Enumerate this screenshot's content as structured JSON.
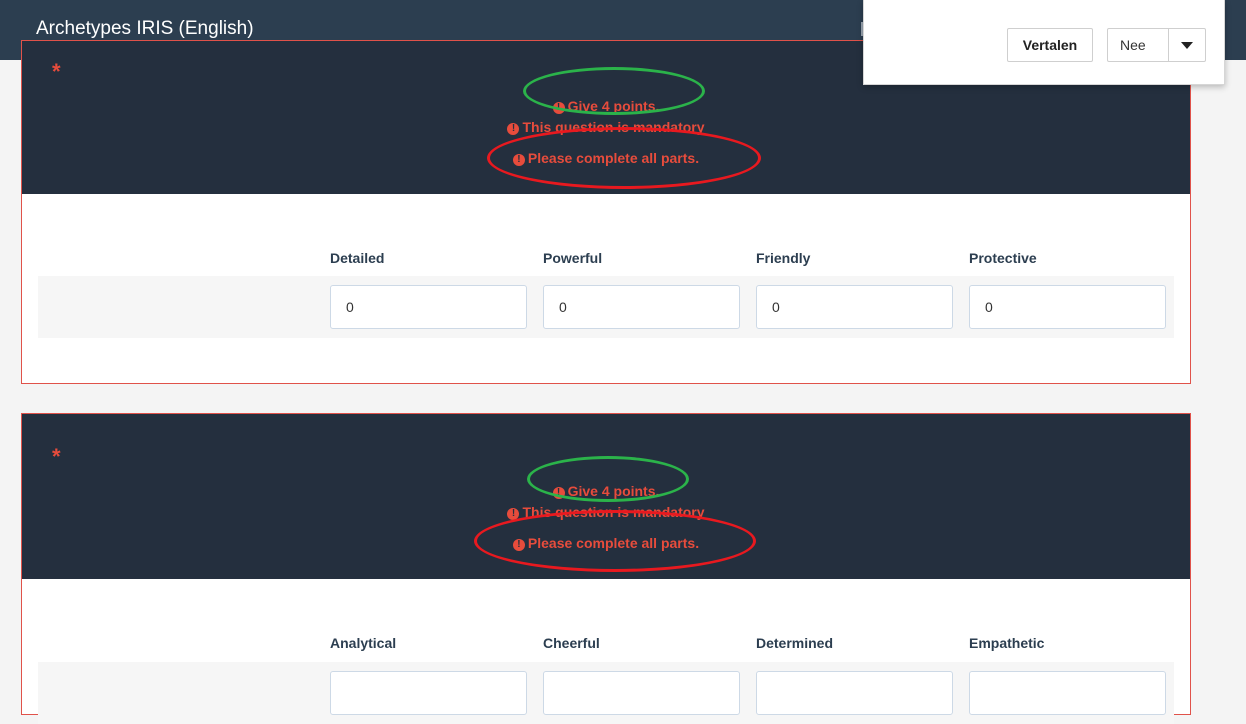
{
  "app": {
    "title": "Archetypes IRIS (English)"
  },
  "translate_popup": {
    "translate_label": "Vertalen",
    "select_value": "Nee"
  },
  "questions": [
    {
      "required_marker": "*",
      "messages": {
        "points": "Give 4 points.",
        "mandatory": "This question is mandatory",
        "complete": "Please complete all parts."
      },
      "columns": [
        "Detailed",
        "Powerful",
        "Friendly",
        "Protective"
      ],
      "values": [
        "0",
        "0",
        "0",
        "0"
      ]
    },
    {
      "required_marker": "*",
      "messages": {
        "points": "Give 4 points.",
        "mandatory": "This question is mandatory",
        "complete": "Please complete all parts."
      },
      "columns": [
        "Analytical",
        "Cheerful",
        "Determined",
        "Empathetic"
      ]
    }
  ],
  "icons": {
    "error": "exclamation-circle-icon",
    "dropdown": "caret-down-icon"
  },
  "colors": {
    "topbar": "#2c3e50",
    "question_header": "#242f3e",
    "error_text": "#e74c3c",
    "annotation_green": "#2bb34a",
    "annotation_red": "#e8191f"
  }
}
